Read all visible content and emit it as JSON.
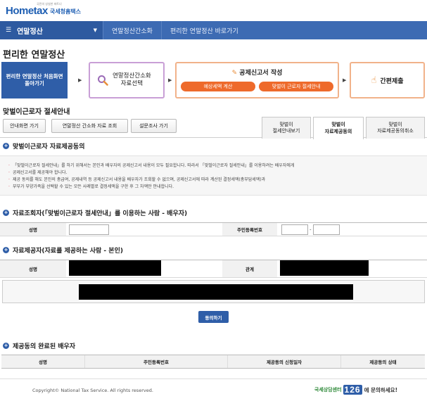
{
  "header": {
    "logo_main": "Hometax",
    "logo_sub": "국세청홈택스",
    "logo_tag": "국민의 성실한 파트너"
  },
  "nav": {
    "menu_label": "연말정산",
    "breadcrumbs": [
      "연말정산간소화",
      "편리한 연말정산 바로가기"
    ]
  },
  "page_title": "편리한 연말정산",
  "steps": {
    "start_label": "편리한 연말정산 처음화면 돌아가기",
    "select_label_1": "연말정산간소화",
    "select_label_2": "자료선택",
    "write_title": "공제신고서 작성",
    "estimate_button": "예상세액 계산",
    "dual_income_button": "맞벌이 근로자 절세안내",
    "simple_submit_label": "간편제출"
  },
  "section_title": "맞벌이근로자 절세안내",
  "toolbar": {
    "guide_button": "안내화면 가기",
    "lookup_button": "연말정산 간소화 자료 조회",
    "survey_button": "설문조사 가기"
  },
  "tabs": [
    {
      "line1": "맞벌이",
      "line2": "절세안내보기",
      "active": false
    },
    {
      "line1": "맞벌이",
      "line2": "자료제공동의",
      "active": true
    },
    {
      "line1": "맞벌이",
      "line2": "자료제공동의취소",
      "active": false
    }
  ],
  "consent_section": {
    "title": "맞벌이근로자 자료제공동의",
    "notice": [
      "「맞벌이근로자 절세안내」를 하기 위해서는 본인과 배우자의 공제신고서 내용이 모두 필요합니다. 따라서 「맞벌이근로자 절세안내」를 이용하려는 배우자에게",
      "공제신고서를 제공해야 합니다.",
      "제공 동의를 해도 본인의 총급여, 공제내역 등 공제신고서 내용을 배우자가 조회할 수 없으며, 공제신고서에 따라 계산된 결정세액(총부담세액)과",
      "부부가 부양가족을 선택할 수 있는 모든 사례별로 결정세액을 구한 후 그 차액만 안내합니다."
    ]
  },
  "lookup_user": {
    "title": "자료조회자(「맞벌이근로자 절세안내」를 이용하는 사람 - 배우자)",
    "name_label": "성명",
    "name_value": "",
    "rrn_label": "주민등록번호",
    "rrn_sep": "-"
  },
  "provider": {
    "title": "자료제공자(자료를 제공하는 사람 - 본인)",
    "name_label": "성명",
    "relation_label": "관계"
  },
  "consent_button": "동의하기",
  "completed": {
    "title": "제공동의 완료된 배우자",
    "columns": [
      "성명",
      "주민등록번호",
      "제공동의 신청일자",
      "제공동의 상태"
    ]
  },
  "footer": {
    "copyright": "Copyright© National Tax Service. All rights reserved.",
    "cc_sub": "국세상담센터",
    "cc_number": "126",
    "cc_text": "에 문의하세요!"
  },
  "colors": {
    "brand_blue": "#2f5ea8",
    "nav_blue": "#3d6bb3",
    "accent_orange": "#ee6a2b"
  }
}
